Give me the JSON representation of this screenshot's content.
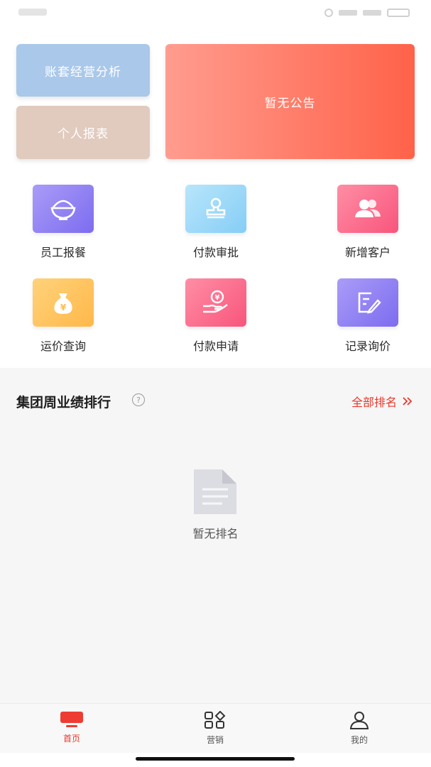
{
  "cards": {
    "analysis_label": "账套经营分析",
    "report_label": "个人报表",
    "notice_text": "暂无公告"
  },
  "grid": {
    "items": [
      {
        "label": "员工报餐",
        "icon": "rice-bowl-icon"
      },
      {
        "label": "付款审批",
        "icon": "stamp-icon"
      },
      {
        "label": "新增客户",
        "icon": "users-icon"
      },
      {
        "label": "运价查询",
        "icon": "money-bag-icon"
      },
      {
        "label": "付款申请",
        "icon": "coin-hand-icon"
      },
      {
        "label": "记录询价",
        "icon": "edit-note-icon"
      }
    ]
  },
  "ranking": {
    "title": "集团周业绩排行",
    "all_label": "全部排名",
    "empty_text": "暂无排名"
  },
  "tabbar": {
    "items": [
      {
        "label": "首页",
        "active": true
      },
      {
        "label": "营销",
        "active": false
      },
      {
        "label": "我的",
        "active": false
      }
    ]
  },
  "colors": {
    "accent": "#e8382d",
    "notice_start": "#ff9c8f",
    "notice_end": "#ff6249"
  }
}
